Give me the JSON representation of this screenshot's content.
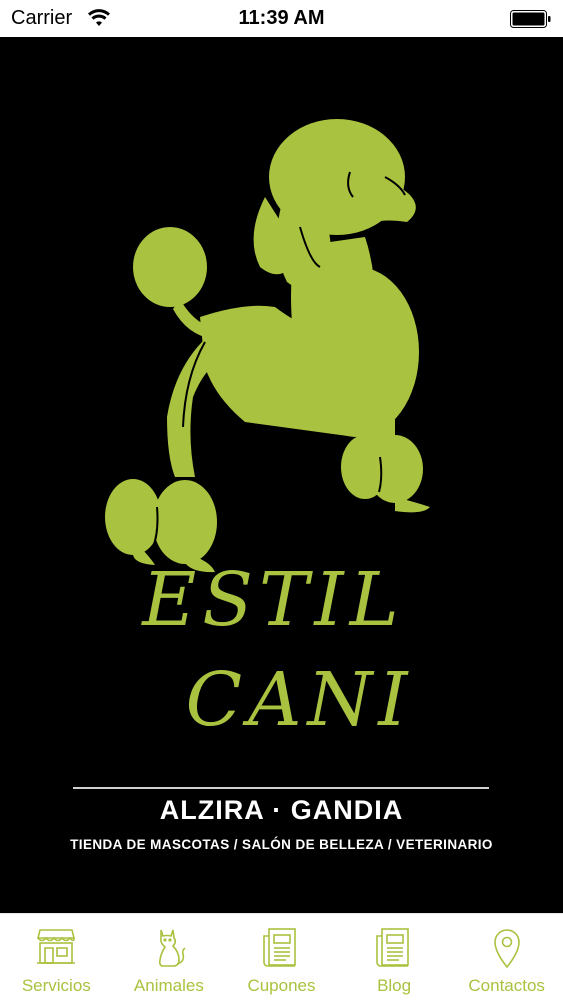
{
  "status_bar": {
    "carrier": "Carrier",
    "time": "11:39 AM"
  },
  "splash": {
    "brand_line_1": "ESTIL",
    "brand_line_2": "CANI",
    "cities": "ALZIRA · GANDIA",
    "tagline": "TIENDA DE MASCOTAS / SALÓN DE BELLEZA / VETERINARIO"
  },
  "tabs": [
    {
      "label": "Servicios",
      "icon": "storefront-icon"
    },
    {
      "label": "Animales",
      "icon": "cat-icon"
    },
    {
      "label": "Cupones",
      "icon": "coupon-icon"
    },
    {
      "label": "Blog",
      "icon": "newspaper-icon"
    },
    {
      "label": "Contactos",
      "icon": "map-pin-icon"
    }
  ],
  "colors": {
    "brand_green": "#a9c23f",
    "background": "#000000",
    "tab_bar": "#ffffff"
  }
}
